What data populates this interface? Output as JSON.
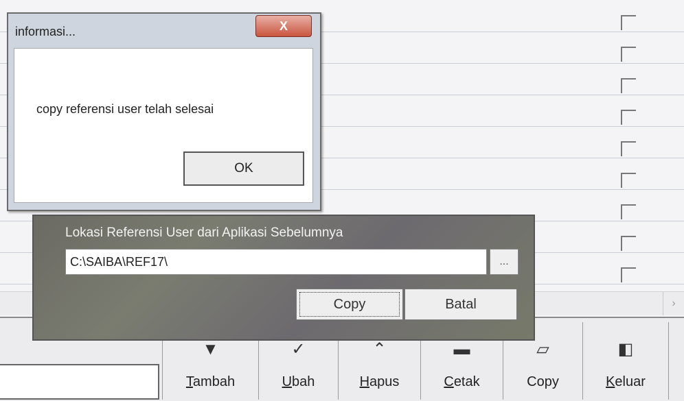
{
  "info_dialog": {
    "title": "informasi...",
    "close_label": "X",
    "message": "copy referensi user telah selesai",
    "ok_label": "OK"
  },
  "copy_panel": {
    "title": "Lokasi Referensi User dari Aplikasi Sebelumnya",
    "path_value": "C:\\SAIBA\\REF17\\",
    "browse_label": "...",
    "copy_label": "Copy",
    "cancel_label": "Batal"
  },
  "toolbar": {
    "buttons": [
      {
        "mnemonic": "T",
        "rest": "ambah",
        "icon": "add-icon"
      },
      {
        "mnemonic": "U",
        "rest": "bah",
        "icon": "check-icon"
      },
      {
        "mnemonic": "H",
        "rest": "apus",
        "icon": "delete-icon"
      },
      {
        "mnemonic": "C",
        "rest": "etak",
        "icon": "print-icon"
      },
      {
        "mnemonic": "",
        "rest": "Copy",
        "icon": "folder-icon"
      },
      {
        "mnemonic": "K",
        "rest": "eluar",
        "icon": "exit-door-icon"
      }
    ]
  },
  "scrollbar": {
    "right_arrow": "›"
  }
}
